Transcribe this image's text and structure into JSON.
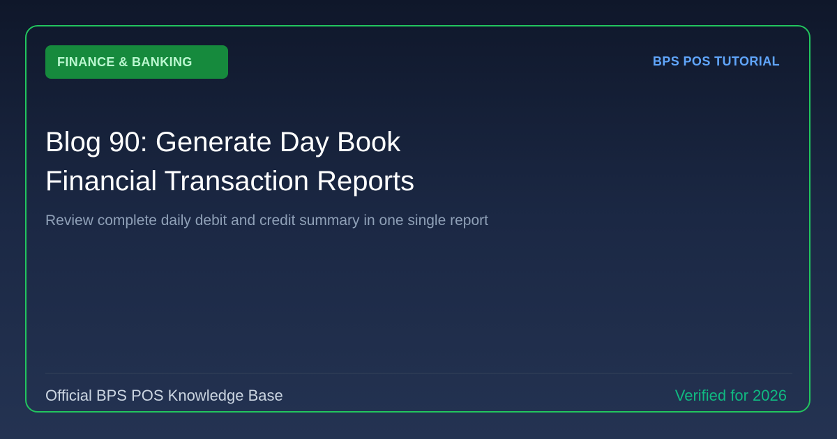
{
  "card": {
    "category": "FINANCE & BANKING",
    "brand": "BPS POS TUTORIAL",
    "title_lines": [
      "Blog 90: Generate Day Book",
      "Financial Transaction Reports"
    ],
    "subtitle": "Review complete daily debit and credit summary in one single report",
    "footer": {
      "source": "Official BPS POS Knowledge Base",
      "verified": "Verified for 2026"
    }
  },
  "colors": {
    "border_accent": "#22c55e",
    "badge_bg": "#168a3d",
    "badge_text": "#bbf7d0",
    "brand_text": "#60a5fa",
    "verified_text": "#10b981"
  }
}
